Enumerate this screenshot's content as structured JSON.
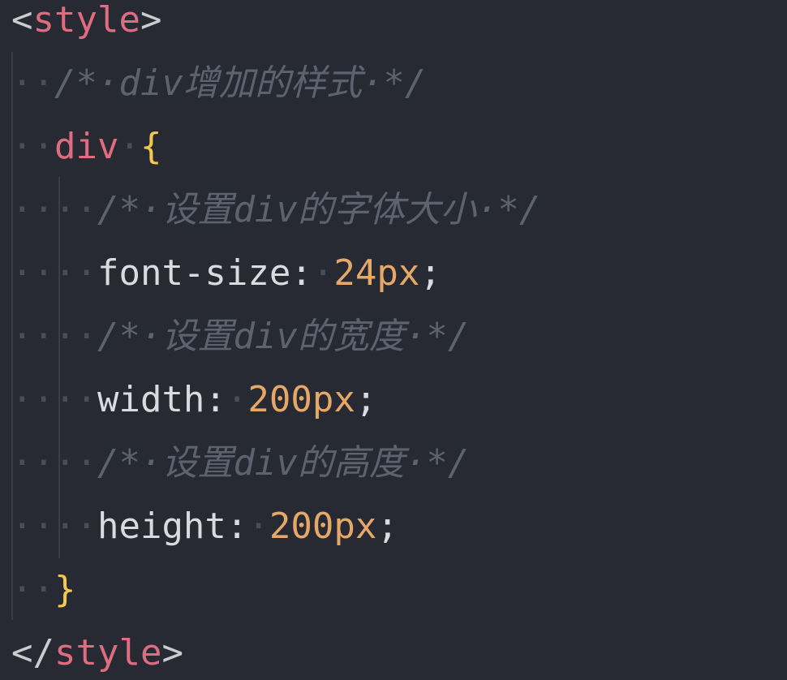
{
  "editor": {
    "lines": [
      {
        "tokens": [
          {
            "t": "<",
            "c": "tag-bracket"
          },
          {
            "t": "style",
            "c": "tag-name"
          },
          {
            "t": ">",
            "c": "tag-bracket"
          }
        ]
      },
      {
        "tokens": [
          {
            "t": "··",
            "c": "ws"
          },
          {
            "t": "/*·div增加的样式·*/",
            "c": "comment"
          }
        ]
      },
      {
        "tokens": [
          {
            "t": "··",
            "c": "ws"
          },
          {
            "t": "div",
            "c": "selector"
          },
          {
            "t": "·",
            "c": "ws"
          },
          {
            "t": "{",
            "c": "brace"
          }
        ]
      },
      {
        "tokens": [
          {
            "t": "····",
            "c": "ws"
          },
          {
            "t": "/*·设置div的字体大小·*/",
            "c": "comment"
          }
        ]
      },
      {
        "tokens": [
          {
            "t": "····",
            "c": "ws"
          },
          {
            "t": "font-size",
            "c": "prop"
          },
          {
            "t": ":",
            "c": "punct"
          },
          {
            "t": "·",
            "c": "ws"
          },
          {
            "t": "24px",
            "c": "value"
          },
          {
            "t": ";",
            "c": "punct"
          }
        ]
      },
      {
        "tokens": [
          {
            "t": "····",
            "c": "ws"
          },
          {
            "t": "/*·设置div的宽度·*/",
            "c": "comment"
          }
        ]
      },
      {
        "tokens": [
          {
            "t": "····",
            "c": "ws"
          },
          {
            "t": "width",
            "c": "prop"
          },
          {
            "t": ":",
            "c": "punct"
          },
          {
            "t": "·",
            "c": "ws"
          },
          {
            "t": "200px",
            "c": "value"
          },
          {
            "t": ";",
            "c": "punct"
          }
        ]
      },
      {
        "tokens": [
          {
            "t": "····",
            "c": "ws"
          },
          {
            "t": "/*·设置div的高度·*/",
            "c": "comment"
          }
        ]
      },
      {
        "tokens": [
          {
            "t": "····",
            "c": "ws"
          },
          {
            "t": "height",
            "c": "prop"
          },
          {
            "t": ":",
            "c": "punct"
          },
          {
            "t": "·",
            "c": "ws"
          },
          {
            "t": "200px",
            "c": "value"
          },
          {
            "t": ";",
            "c": "punct"
          }
        ]
      },
      {
        "tokens": [
          {
            "t": "··",
            "c": "ws"
          },
          {
            "t": "}",
            "c": "brace"
          }
        ]
      },
      {
        "tokens": [
          {
            "t": "</",
            "c": "tag-bracket"
          },
          {
            "t": "style",
            "c": "tag-name"
          },
          {
            "t": ">",
            "c": "tag-bracket"
          }
        ]
      }
    ]
  },
  "theme": {
    "background": "#282a33",
    "tag": "#e06c82",
    "brace": "#f2c94c",
    "value": "#e5a869",
    "comment": "#5e626e"
  }
}
